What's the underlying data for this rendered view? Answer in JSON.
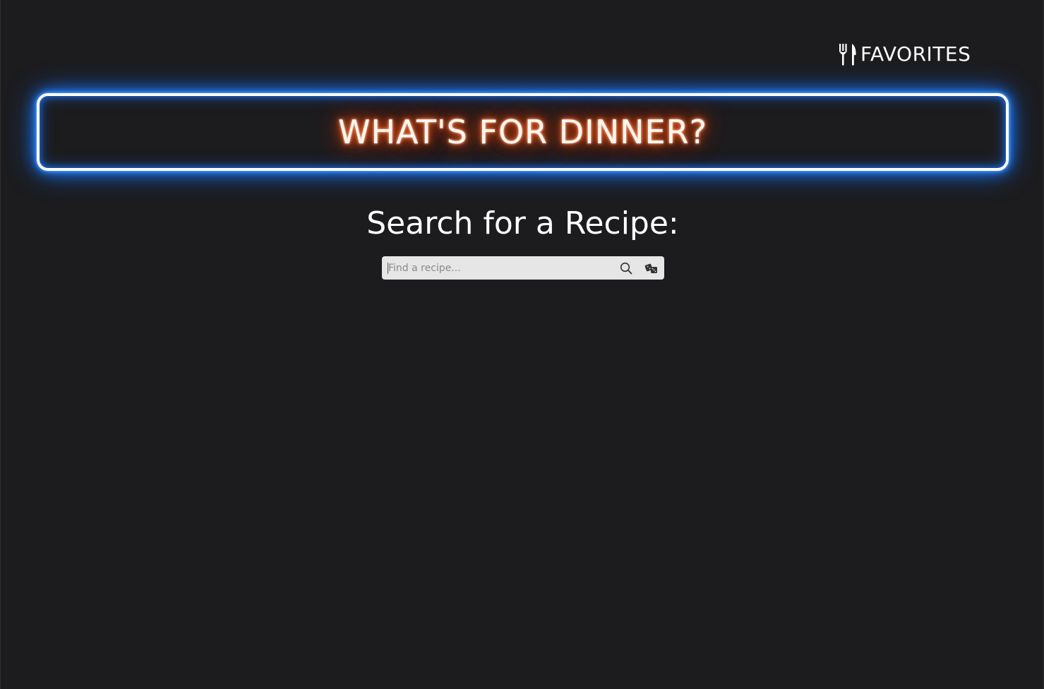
{
  "header": {
    "favorites_label": "FAVORITES",
    "favorites_icon": "utensils-icon"
  },
  "banner": {
    "title": "WHAT'S FOR DINNER?",
    "border_glow_color": "#1e78ff",
    "text_glow_color": "#e0470f"
  },
  "search": {
    "heading": "Search for a Recipe:",
    "placeholder": "Find a recipe...",
    "value": "",
    "search_icon": "search-icon",
    "random_icon": "dice-icon"
  },
  "theme": {
    "background": "#1c1c1e",
    "text": "#ffffff",
    "search_bar_bg": "#e6e6e6"
  }
}
